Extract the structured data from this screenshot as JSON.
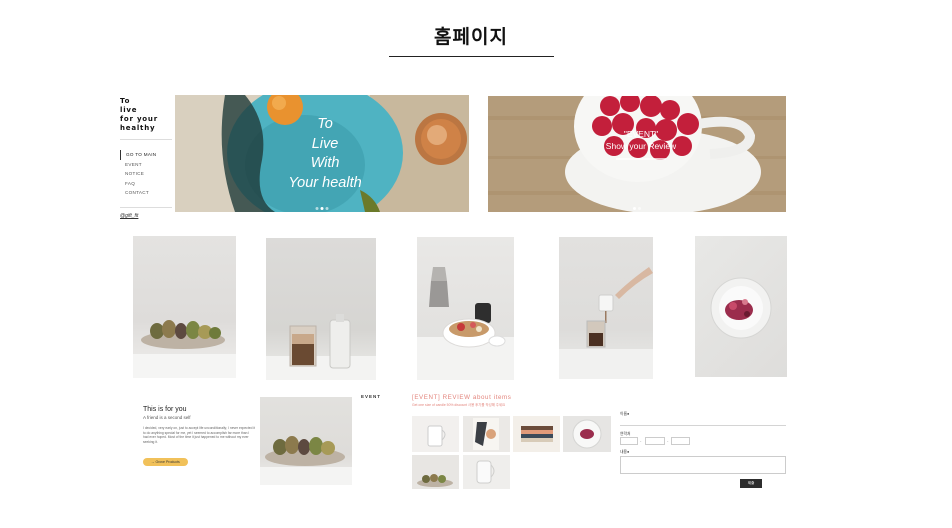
{
  "page": {
    "title": "홈페이지"
  },
  "sidebar": {
    "brand": "To\nlive\nfor your\nhealthy",
    "nav": [
      {
        "label": "GO TO MAIN",
        "active": true
      },
      {
        "label": "EVENT"
      },
      {
        "label": "NOTICE"
      },
      {
        "label": "FAQ"
      },
      {
        "label": "CONTACT"
      }
    ],
    "handle": "@gift_fit"
  },
  "hero_left": {
    "text": "To\nLive\nWith\nYour health"
  },
  "hero_right": {
    "text": "\"EVENT\"\nShow your Review"
  },
  "promo": {
    "title": "This is for you",
    "subtitle": "A friend is a second self",
    "body": "I decided, very early on, just to accept life unconditionally; I never expected it to do anything special for me, yet I seemed to accomplish far more than I had ever hoped. Most of the time it just happened to me without my ever seeking it.",
    "button": "→ Grove Products",
    "tag": "EVENT"
  },
  "review": {
    "title": "[EVENT] REVIEW about items",
    "subtitle": "Get one size of candle 50% discount 사용 후기를 작성해 주세요"
  },
  "form": {
    "name_label": "이름●",
    "phone_label": "연락처",
    "phone_sep": "-",
    "review_label": "내용●",
    "submit_label": "제출"
  },
  "colors": {
    "accent_coral": "#e3857d",
    "button_yellow": "#f1c15a",
    "submit_dark": "#2d2d2d",
    "hero_teal": "#4fb3c2"
  }
}
